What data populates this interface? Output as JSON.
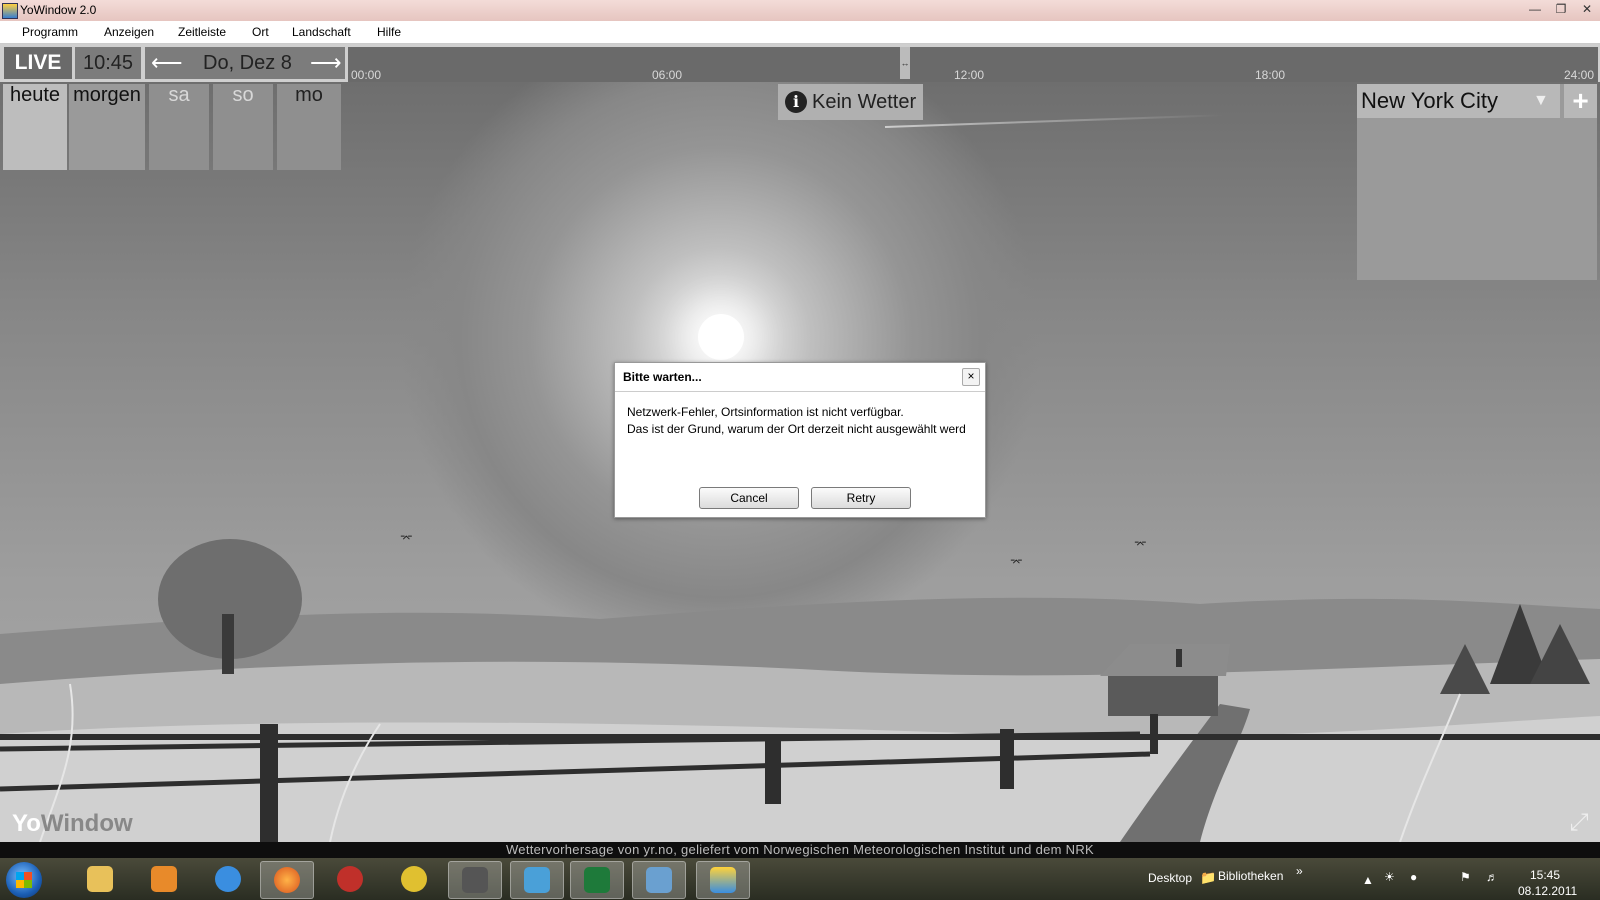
{
  "window": {
    "title": "YoWindow 2.0"
  },
  "menu": [
    "Programm",
    "Anzeigen",
    "Zeitleiste",
    "Ort",
    "Landschaft",
    "Hilfe"
  ],
  "timebar": {
    "live_label": "LIVE",
    "time": "10:45",
    "date": "Do, Dez 8",
    "timeline_labels": [
      "00:00",
      "06:00",
      "12:00",
      "18:00",
      "24:00"
    ]
  },
  "days": [
    "heute",
    "morgen",
    "sa",
    "so",
    "mo"
  ],
  "weather_button": {
    "label": "Kein Wetter"
  },
  "location": {
    "city": "New York City"
  },
  "dialog": {
    "title": "Bitte warten...",
    "message_line1": "Netzwerk-Fehler, Ortsinformation ist nicht verfügbar.",
    "message_line2": "Das ist der Grund, warum der Ort derzeit nicht ausgewählt werd",
    "cancel_label": "Cancel",
    "retry_label": "Retry"
  },
  "watermark": {
    "prefix": "Yo",
    "suffix": "Window"
  },
  "credit": "Wettervorhersage von yr.no, geliefert vom Norwegischen Meteorologischen Institut und dem NRK",
  "taskbar": {
    "toolbars": [
      "Desktop",
      "Bibliotheken"
    ],
    "clock_time": "15:45",
    "clock_date": "08.12.2011"
  },
  "colors": {
    "dialog_bg": "#ffffff",
    "taskbar": "#2a2d22",
    "panel_gray": "#9a9a9a"
  }
}
